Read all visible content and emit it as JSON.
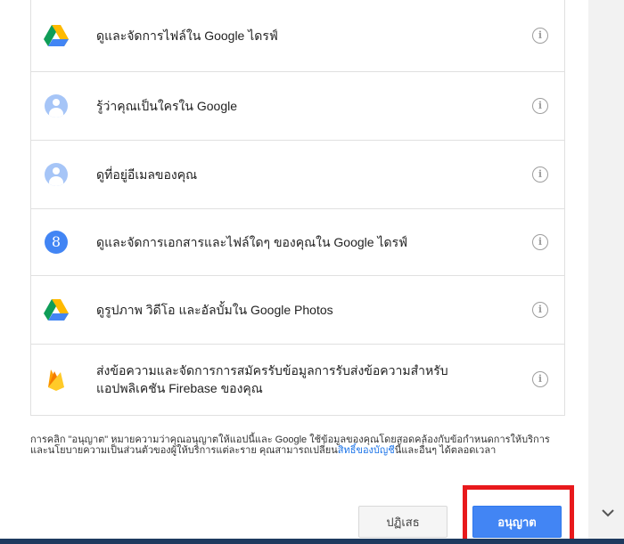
{
  "permissions": [
    {
      "icon": "google-drive-icon",
      "text": "ดูและจัดการไฟล์ใน Google ไดรฟ์"
    },
    {
      "icon": "person-icon",
      "text": "รู้ว่าคุณเป็นใครใน Google"
    },
    {
      "icon": "person-icon",
      "text": "ดูที่อยู่อีเมลของคุณ"
    },
    {
      "icon": "google-plus-icon",
      "text": "ดูและจัดการเอกสารและไฟล์ใดๆ ของคุณใน Google ไดรฟ์"
    },
    {
      "icon": "google-drive-icon",
      "text": "ดูรูปภาพ วิดีโอ และอัลบั้มใน Google Photos"
    },
    {
      "icon": "firebase-icon",
      "text": "ส่งข้อความและจัดการการสมัครรับข้อมูลการรับส่งข้อความสำหรับแอปพลิเคชัน Firebase ของคุณ"
    }
  ],
  "info_glyph": "i",
  "gplus_glyph": "8",
  "disclaimer": {
    "text": "การคลิก \"อนุญาต\" หมายความว่าคุณอนุญาตให้แอปนี้และ Google ใช้ข้อมูลของคุณโดยสอดคล้องกับข้อกำหนดการให้บริการและนโยบายความเป็นส่วนตัวของผู้ให้บริการแต่ละราย คุณสามารถเปลี่ยน",
    "link": "สิทธิ์ของบัญชี",
    "suffix": "นี้และอื่นๆ ได้ตลอดเวลา"
  },
  "buttons": {
    "deny": "ปฏิเสธ",
    "allow": "อนุญาต"
  },
  "colors": {
    "allow_button": "#4285f4",
    "highlight": "#e8191c",
    "link": "#1a73e8"
  }
}
